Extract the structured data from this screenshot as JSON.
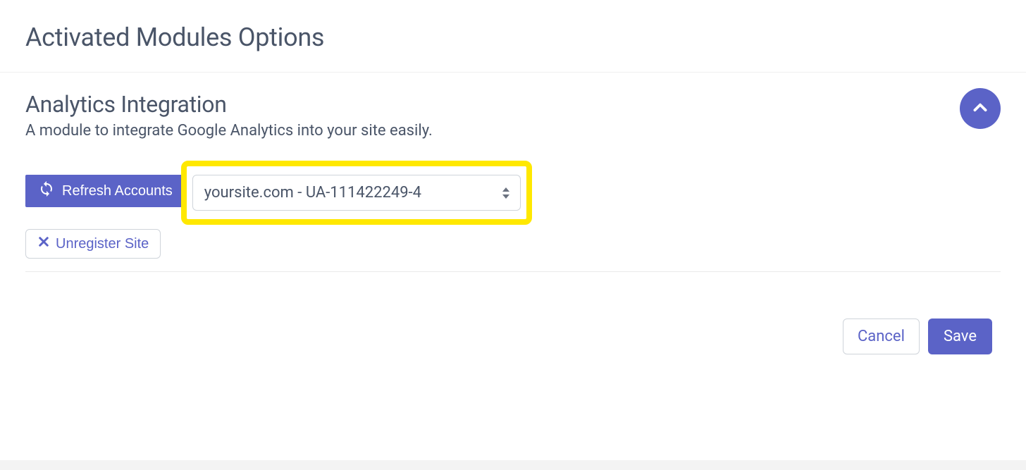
{
  "header": {
    "title": "Activated Modules Options"
  },
  "module": {
    "title": "Analytics Integration",
    "description": "A module to integrate Google Analytics into your site easily.",
    "refresh_label": "Refresh Accounts",
    "account_selected": "yoursite.com - UA-111422249-4",
    "unregister_label": "Unregister Site"
  },
  "footer": {
    "cancel_label": "Cancel",
    "save_label": "Save"
  },
  "colors": {
    "accent": "#5b63c7",
    "highlight": "#ffe800"
  }
}
